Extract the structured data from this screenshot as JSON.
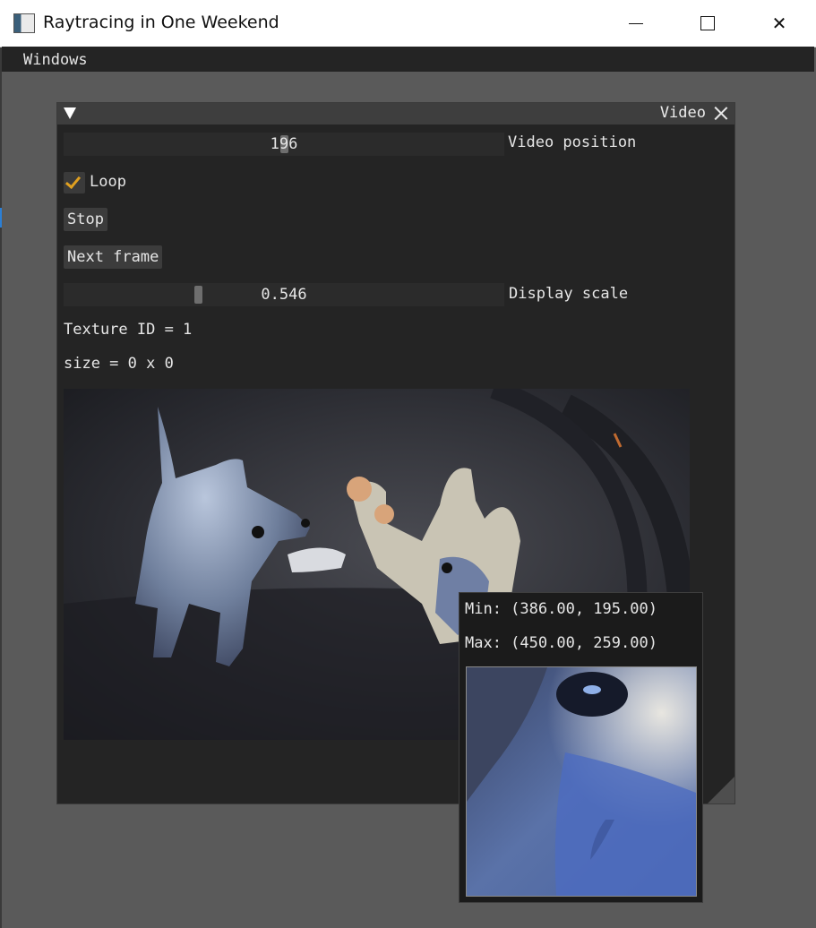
{
  "os_window": {
    "title": "Raytracing in One Weekend",
    "controls": {
      "minimize_icon": "minimize-icon",
      "maximize_icon": "maximize-icon",
      "close_icon": "close-icon",
      "close_label": "✕"
    }
  },
  "menubar": {
    "items": [
      {
        "label": "Windows"
      }
    ]
  },
  "video_window": {
    "title": "Video",
    "video_position": {
      "value": "196",
      "label": "Video position",
      "fraction": 0.5
    },
    "loop": {
      "label": "Loop",
      "checked": true
    },
    "stop_label": "Stop",
    "next_frame_label": "Next frame",
    "display_scale": {
      "value": "0.546",
      "label": "Display scale",
      "fraction": 0.3
    },
    "texture_id_text": "Texture ID = 1",
    "size_text": "size = 0 x 0"
  },
  "tooltip": {
    "min_text": "Min: (386.00, 195.00)",
    "max_text": "Max: (450.00, 259.00)"
  },
  "colors": {
    "accent": "#e0a020",
    "window_bg": "#242424",
    "title_bg": "#3e3e3e",
    "desktop_bg": "#5a5a5a"
  }
}
